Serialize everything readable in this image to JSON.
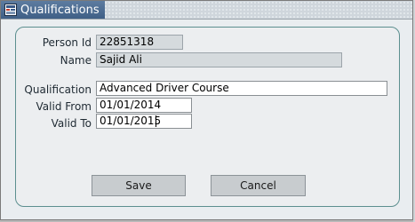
{
  "window": {
    "title": "Qualifications"
  },
  "form": {
    "person_id": {
      "label": "Person Id",
      "value": "22851318"
    },
    "name": {
      "label": "Name",
      "value": "Sajid Ali"
    },
    "qualification": {
      "label": "Qualification",
      "value": "Advanced Driver Course"
    },
    "valid_from": {
      "label": "Valid From",
      "value": "01/01/2014"
    },
    "valid_to": {
      "label": "Valid To",
      "value": "01/01/2015"
    }
  },
  "buttons": {
    "save_label": "Save",
    "cancel_label": "Cancel"
  },
  "colors": {
    "panel_border": "#5c8f8f",
    "readonly_field": "#d5dadd",
    "title_bar": "#4a6a90"
  },
  "icons": {
    "window": "form-window-icon"
  }
}
